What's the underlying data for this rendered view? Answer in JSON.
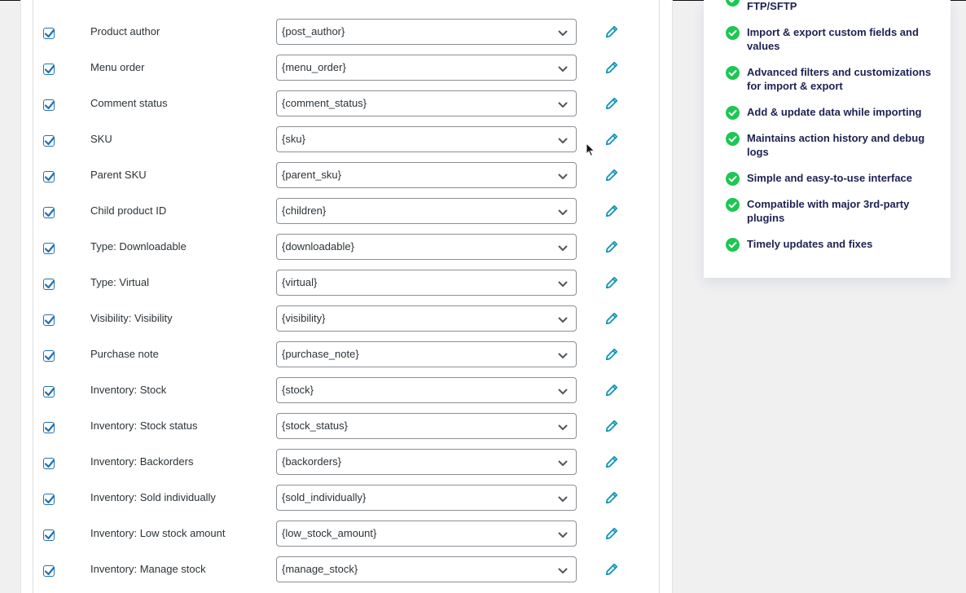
{
  "mapping_rows": [
    {
      "label": "Product author",
      "value": "{post_author}",
      "checked": true
    },
    {
      "label": "Menu order",
      "value": "{menu_order}",
      "checked": true
    },
    {
      "label": "Comment status",
      "value": "{comment_status}",
      "checked": true
    },
    {
      "label": "SKU",
      "value": "{sku}",
      "checked": true
    },
    {
      "label": "Parent SKU",
      "value": "{parent_sku}",
      "checked": true
    },
    {
      "label": "Child product ID",
      "value": "{children}",
      "checked": true
    },
    {
      "label": "Type: Downloadable",
      "value": "{downloadable}",
      "checked": true
    },
    {
      "label": "Type: Virtual",
      "value": "{virtual}",
      "checked": true
    },
    {
      "label": "Visibility: Visibility",
      "value": "{visibility}",
      "checked": true
    },
    {
      "label": "Purchase note",
      "value": "{purchase_note}",
      "checked": true
    },
    {
      "label": "Inventory: Stock",
      "value": "{stock}",
      "checked": true
    },
    {
      "label": "Inventory: Stock status",
      "value": "{stock_status}",
      "checked": true
    },
    {
      "label": "Inventory: Backorders",
      "value": "{backorders}",
      "checked": true
    },
    {
      "label": "Inventory: Sold individually",
      "value": "{sold_individually}",
      "checked": true
    },
    {
      "label": "Inventory: Low stock amount",
      "value": "{low_stock_amount}",
      "checked": true
    },
    {
      "label": "Inventory: Manage stock",
      "value": "{manage_stock}",
      "checked": true
    }
  ],
  "features": [
    {
      "text": "FTP/SFTP"
    },
    {
      "text": "Import & export custom fields and values"
    },
    {
      "text": "Advanced filters and customizations for import & export"
    },
    {
      "text": "Add & update data while importing"
    },
    {
      "text": "Maintains action history and debug logs"
    },
    {
      "text": "Simple and easy-to-use interface"
    },
    {
      "text": "Compatible with major 3rd-party plugins"
    },
    {
      "text": "Timely updates and fixes"
    }
  ],
  "colors": {
    "checkbox_accent": "#2271b1",
    "edit_icon": "#0e94b5",
    "feature_check": "#1dc754",
    "feature_text": "#1d2251"
  },
  "icons": {
    "row_checkbox": "checkbox-checked-icon",
    "select_arrow": "chevron-down-icon",
    "row_edit": "pencil-icon",
    "feature_bullet": "check-circle-icon"
  }
}
